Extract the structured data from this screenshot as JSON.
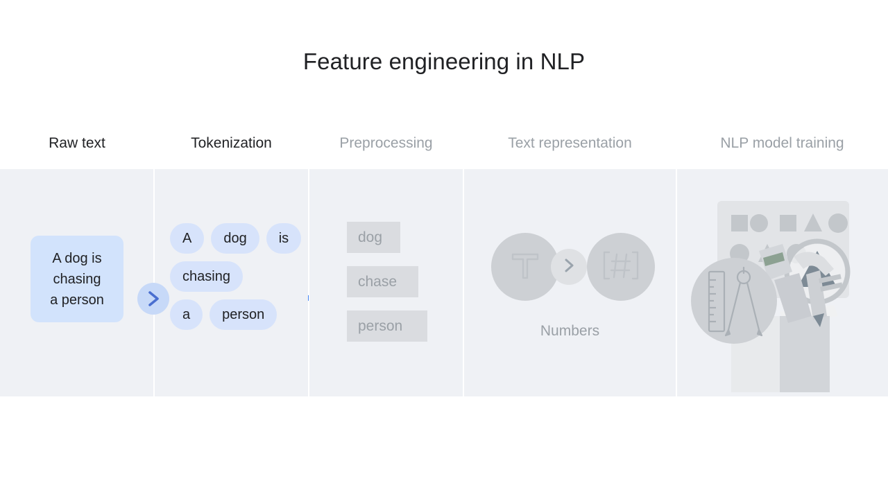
{
  "slide": {
    "title": "Feature engineering in NLP",
    "background_color": "#ffffff"
  },
  "colors": {
    "accent_blue": "#4285f4",
    "marker_circle": "#c7d9f8",
    "pending_bar": "#dadce0",
    "panel_bg": "#eff1f5",
    "chip_bg": "#d7e3fb",
    "raw_card_bg": "#d2e3fc",
    "text_active": "#202124",
    "text_inactive": "#9aa0a6",
    "grey_box": "#dadce0",
    "grey_circle": "#cdd0d4"
  },
  "stepper": {
    "steps": [
      {
        "label": "Raw text",
        "state": "complete"
      },
      {
        "label": "Tokenization",
        "state": "current"
      },
      {
        "label": "Preprocessing",
        "state": "pending"
      },
      {
        "label": "Text representation",
        "state": "pending"
      },
      {
        "label": "NLP model training",
        "state": "pending"
      }
    ],
    "marker_icon": "chevron-right-icon",
    "progress_position": "between-raw-text-and-tokenization"
  },
  "panels": {
    "raw_text": {
      "card_text": "A dog is\nchasing\na person"
    },
    "tokenization": {
      "rows": [
        [
          "A",
          "dog",
          "is"
        ],
        [
          "chasing"
        ],
        [
          "a",
          "person"
        ]
      ]
    },
    "preprocessing": {
      "boxes": [
        "dog",
        "chase",
        "person"
      ]
    },
    "text_representation": {
      "left_icon": "text-t-icon",
      "middle_icon": "chevron-right-icon",
      "right_icon": "bracket-hash-icon",
      "caption": "Numbers"
    },
    "nlp_model_training": {
      "illustration": "toolbox-shapes-illustration",
      "elements": [
        "shapes-board",
        "magnifier-with-triangle",
        "ruler-and-compass-circle",
        "open-box-with-tools"
      ],
      "board_shapes": [
        [
          "square",
          "circle",
          "square",
          "triangle",
          "circle"
        ],
        [
          "circle",
          "triangle",
          "circle"
        ],
        [
          "triangle"
        ]
      ]
    }
  }
}
